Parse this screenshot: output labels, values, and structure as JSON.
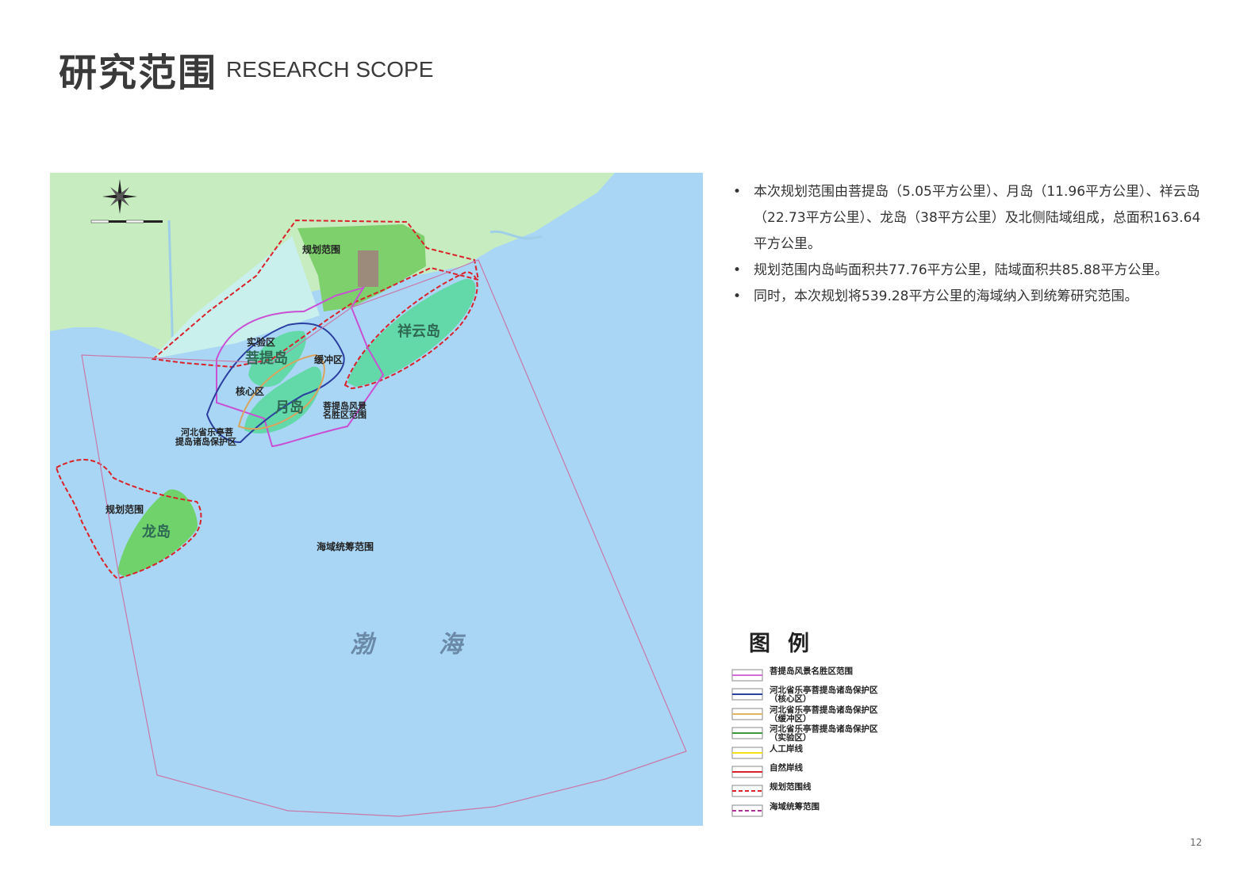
{
  "header": {
    "title_zh": "研究范围",
    "title_en": "RESEARCH SCOPE"
  },
  "bullets": [
    "本次规划范围由菩提岛（5.05平方公里）、月岛（11.96平方公里）、祥云岛（22.73平方公里）、龙岛（38平方公里）及北侧陆域组成，总面积163.64平方公里。",
    "规划范围内岛屿面积共77.76平方公里，陆域面积共85.88平方公里。",
    "同时，本次规划将539.28平方公里的海域纳入到统筹研究范围。"
  ],
  "bullet_symbol": "•",
  "map": {
    "labels": {
      "plan_scope_north": "规划范围",
      "xiangyun": "祥云岛",
      "experiment_zone": "实验区",
      "puti": "菩提岛",
      "buffer_zone": "缓冲区",
      "core_zone": "核心区",
      "yuedao": "月岛",
      "scenic_area": "菩提岛风景\n名胜区范围",
      "reserve": "河北省乐亭菩\n提岛诸岛保护区",
      "plan_scope_long": "规划范围",
      "longdao": "龙岛",
      "sea_scope": "海域统筹范围",
      "bohai_1": "渤",
      "bohai_2": "海"
    },
    "colors": {
      "sea": "#a9d6f5",
      "land": "#c6ecbf",
      "island": "#63d8a9",
      "green": "#6fd26b",
      "plan_line": "#d9222a",
      "scenic_line": "#c94fd3",
      "core_line": "#2b3fa0",
      "buffer_line": "#d8a45f",
      "sea_line": "#c978a8"
    }
  },
  "legend": {
    "title": "图例",
    "items": [
      {
        "label": "菩提岛风景名胜区范围",
        "color": "#d46cd6",
        "style": "solid"
      },
      {
        "label": "河北省乐亭菩提岛诸岛保护区\n（核心区）",
        "color": "#2b3fa0",
        "style": "solid"
      },
      {
        "label": "河北省乐亭菩提岛诸岛保护区\n（缓冲区）",
        "color": "#e0b26a",
        "style": "solid"
      },
      {
        "label": "河北省乐亭菩提岛诸岛保护区\n（实验区）",
        "color": "#3c9a3c",
        "style": "solid"
      },
      {
        "label": "人工岸线",
        "color": "#f2e21a",
        "style": "solid"
      },
      {
        "label": "自然岸线",
        "color": "#d9222a",
        "style": "solid"
      },
      {
        "label": "规划范围线",
        "color": "#d9222a",
        "style": "dashed"
      },
      {
        "label": "海域统筹范围",
        "color": "#b0309c",
        "style": "dashed"
      }
    ]
  },
  "page_number": "12"
}
